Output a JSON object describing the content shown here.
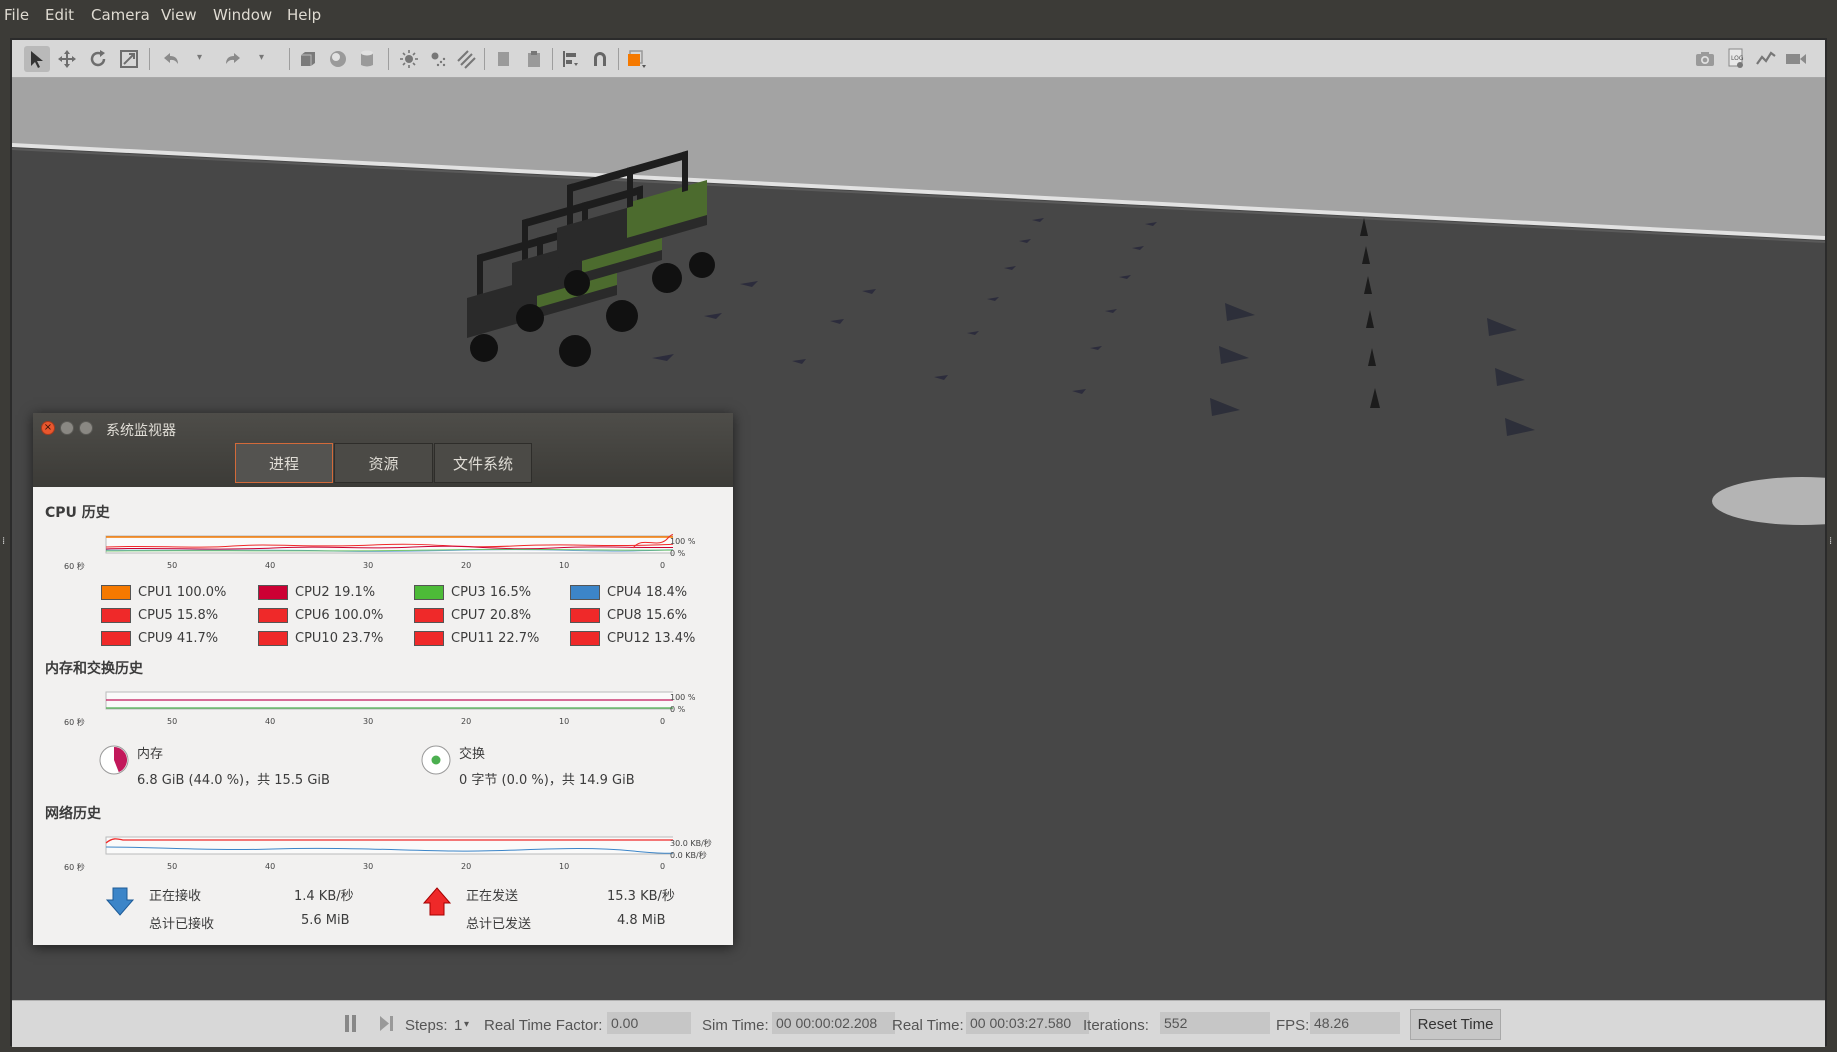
{
  "menu": {
    "items": [
      "File",
      "Edit",
      "Camera",
      "View",
      "Window",
      "Help"
    ]
  },
  "toolbar": {
    "left_icons": [
      "select-arrow-icon",
      "translate-icon",
      "rotate-icon",
      "scale-icon",
      "undo-icon",
      "undo-dropdown-icon",
      "redo-icon",
      "redo-dropdown-icon",
      "box-shape-icon",
      "sphere-shape-icon",
      "cylinder-shape-icon",
      "point-light-icon",
      "spot-light-icon",
      "directional-light-icon",
      "copy-icon",
      "paste-icon",
      "align-icon",
      "snap-magnet-icon",
      "view-angle-icon"
    ],
    "right_icons": [
      "screenshot-icon",
      "log-icon",
      "plot-icon",
      "video-record-icon"
    ]
  },
  "sysmon": {
    "title": "系统监视器",
    "tabs": [
      "进程",
      "资源",
      "文件系统"
    ],
    "active_tab": "进程",
    "cpu": {
      "title": "CPU 历史",
      "x_ticks": [
        "60 秒",
        "50",
        "40",
        "30",
        "20",
        "10",
        "0"
      ],
      "y_ticks": [
        "100 %",
        "0 %"
      ],
      "items": [
        {
          "label": "CPU1",
          "value": "100.0%",
          "color": "#f57900"
        },
        {
          "label": "CPU2",
          "value": "19.1%",
          "color": "#cc0033"
        },
        {
          "label": "CPU3",
          "value": "16.5%",
          "color": "#4dbb38"
        },
        {
          "label": "CPU4",
          "value": "18.4%",
          "color": "#3c85c8"
        },
        {
          "label": "CPU5",
          "value": "15.8%",
          "color": "#ef2929"
        },
        {
          "label": "CPU6",
          "value": "100.0%",
          "color": "#ef2929"
        },
        {
          "label": "CPU7",
          "value": "20.8%",
          "color": "#ef2929"
        },
        {
          "label": "CPU8",
          "value": "15.6%",
          "color": "#ef2929"
        },
        {
          "label": "CPU9",
          "value": "41.7%",
          "color": "#ef2929"
        },
        {
          "label": "CPU10",
          "value": "23.7%",
          "color": "#ef2929"
        },
        {
          "label": "CPU11",
          "value": "22.7%",
          "color": "#ef2929"
        },
        {
          "label": "CPU12",
          "value": "13.4%",
          "color": "#ef2929"
        }
      ]
    },
    "memory": {
      "title": "内存和交换历史",
      "x_ticks": [
        "60 秒",
        "50",
        "40",
        "30",
        "20",
        "10",
        "0"
      ],
      "y_ticks": [
        "100 %",
        "0 %"
      ],
      "mem_label": "内存",
      "mem_value": "6.8 GiB (44.0 %)，共 15.5 GiB",
      "mem_fraction": 0.44,
      "swap_label": "交换",
      "swap_value": "0 字节 (0.0 %)，共 14.9 GiB",
      "swap_fraction": 0.0,
      "mem_color": "#c2185b",
      "swap_color": "#4caf50"
    },
    "network": {
      "title": "网络历史",
      "x_ticks": [
        "60 秒",
        "50",
        "40",
        "30",
        "20",
        "10",
        "0"
      ],
      "y_ticks": [
        "30.0 KB/秒",
        "0.0 KB/秒"
      ],
      "recv_label": "正在接收",
      "recv_value": "1.4 KB/秒",
      "recv_total_label": "总计已接收",
      "recv_total_value": "5.6 MiB",
      "send_label": "正在发送",
      "send_value": "15.3 KB/秒",
      "send_total_label": "总计已发送",
      "send_total_value": "4.8 MiB"
    }
  },
  "statusbar": {
    "steps_label": "Steps:",
    "steps_value": "1",
    "rtf_label": "Real Time Factor:",
    "rtf_value": "0.00",
    "sim_time_label": "Sim Time:",
    "sim_time_value": "00 00:00:02.208",
    "real_time_label": "Real Time:",
    "real_time_value": "00 00:03:27.580",
    "iterations_label": "Iterations:",
    "iterations_value": "552",
    "fps_label": "FPS:",
    "fps_value": "48.26",
    "reset_label": "Reset Time"
  }
}
